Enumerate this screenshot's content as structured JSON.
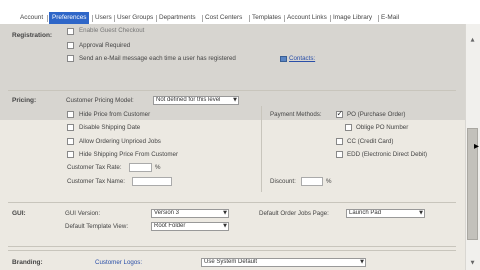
{
  "tabs": [
    "Account",
    "Preferences",
    "Users",
    "User Groups",
    "Departments",
    "Cost Centers",
    "Templates",
    "Account Links",
    "Image Library",
    "E-Mail"
  ],
  "active_tab": "Preferences",
  "registration": {
    "label": "Registration:",
    "option_1": "Enable Guest Checkout",
    "option_2": "Approval Required",
    "option_3": "Send an e-Mail message each time a user has registered",
    "contacts_link": "Contacts:"
  },
  "pricing": {
    "label": "Pricing:",
    "model_label": "Customer Pricing Model:",
    "model_value": "Not defined for this level",
    "options": [
      "Hide Price from Customer",
      "Disable Shipping Date",
      "Allow Ordering Unpriced Jobs",
      "Hide Shipping Price From Customer"
    ],
    "tax_rate_label": "Customer Tax Rate:",
    "tax_rate_unit": "%",
    "tax_name_label": "Customer Tax Name:",
    "payment_label": "Payment Methods:",
    "payment_methods": [
      {
        "label": "PO (Purchase Order)",
        "checked": true
      },
      {
        "label": "Oblige PO Number",
        "checked": false
      },
      {
        "label": "CC (Credit Card)",
        "checked": false
      },
      {
        "label": "EDD (Electronic Direct Debit)",
        "checked": false
      }
    ],
    "discount_label": "Discount:",
    "discount_unit": "%"
  },
  "gui": {
    "label": "GUI:",
    "version_label": "GUI Version:",
    "version_value": "Version 3",
    "order_page_label": "Default Order Jobs Page:",
    "order_page_value": "Launch Pad",
    "template_view_label": "Default Template View:",
    "template_view_value": "Root Folder"
  },
  "branding": {
    "label": "Branding:",
    "logos_label": "Customer Logos:",
    "logos_value": "Use System Default"
  },
  "colors": {
    "active_tab": "#2e66c8",
    "panel": "#ece9e2",
    "link": "#2a4fa8"
  }
}
